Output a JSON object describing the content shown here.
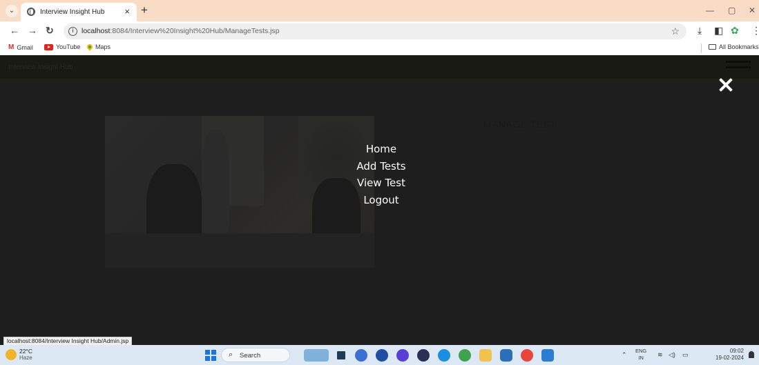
{
  "browser": {
    "tab_title": "Interview Insight Hub",
    "tab_close": "×",
    "new_tab": "+",
    "url_host": "localhost",
    "url_rest": ":8084/Interview%20Insight%20Hub/ManageTests.jsp",
    "bookmarks": [
      {
        "label": "Gmail",
        "icon": "gmail-icon"
      },
      {
        "label": "YouTube",
        "icon": "youtube-icon"
      },
      {
        "label": "Maps",
        "icon": "maps-icon"
      }
    ],
    "all_bookmarks": "All Bookmarks"
  },
  "page": {
    "brand": "Interview Insight Hub",
    "title": "MANAGE TEST",
    "menu": [
      "Home",
      "Add Tests",
      "View Test",
      "Logout"
    ]
  },
  "status_url": "localhost:8084/Interview Insight Hub/Admin.jsp",
  "taskbar": {
    "weather_temp": "22°C",
    "weather_cond": "Haze",
    "search_label": "Search",
    "lang_line1": "ENG",
    "lang_line2": "IN",
    "time": "09:02",
    "date": "19-02-2024"
  },
  "colors": {
    "tab_strip": "#f9dcc4",
    "overlay": "#1e1e1e",
    "menu_text": "#ffffff",
    "taskbar": "#dce8f3"
  }
}
